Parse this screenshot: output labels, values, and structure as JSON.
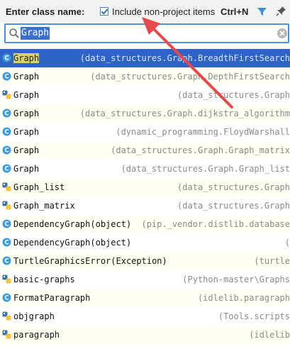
{
  "header": {
    "title": "Enter class name:",
    "include_label": "Include non-project items",
    "include_checked": true,
    "shortcut": "Ctrl+N"
  },
  "search": {
    "value": "Graph"
  },
  "colors": {
    "accent": "#2e63c8",
    "arrow": "#e8494a",
    "class_icon": "#3b9de0",
    "match_highlight": "#d6d36e"
  },
  "results": [
    {
      "name": "Graph",
      "path": "(data_structures.Graph.BreadthFirstSearch",
      "icon": "class-icon",
      "selected": true
    },
    {
      "name": "Graph",
      "path": "(data_structures.Graph.DepthFirstSearch",
      "icon": "class-icon"
    },
    {
      "name": "Graph",
      "path": "(data_structures.Graph",
      "icon": "python-file-icon"
    },
    {
      "name": "Graph",
      "path": "(data_structures.Graph.dijkstra_algorithm",
      "icon": "class-icon"
    },
    {
      "name": "Graph",
      "path": "(dynamic_programming.FloydWarshall",
      "icon": "class-icon"
    },
    {
      "name": "Graph",
      "path": "(data_structures.Graph.Graph_matrix",
      "icon": "class-icon"
    },
    {
      "name": "Graph",
      "path": "(data_structures.Graph.Graph_list",
      "icon": "class-icon"
    },
    {
      "name": "Graph_list",
      "path": "(data_structures.Graph",
      "icon": "python-file-icon"
    },
    {
      "name": "Graph_matrix",
      "path": "(data_structures.Graph",
      "icon": "python-file-icon"
    },
    {
      "name": "DependencyGraph(object)",
      "path": "(pip._vendor.distlib.database",
      "icon": "class-icon"
    },
    {
      "name": "DependencyGraph(object)",
      "path": "(",
      "icon": "class-icon"
    },
    {
      "name": "TurtleGraphicsError(Exception)",
      "path": "(turtle",
      "icon": "class-icon"
    },
    {
      "name": "basic-graphs",
      "path": "(Python-master\\Graphs",
      "icon": "python-file-icon"
    },
    {
      "name": "FormatParagraph",
      "path": "(idlelib.paragraph",
      "icon": "class-icon"
    },
    {
      "name": "objgraph",
      "path": "(Tools.scripts",
      "icon": "python-file-icon"
    },
    {
      "name": "paragraph",
      "path": "(idlelib",
      "icon": "python-file-icon"
    }
  ]
}
